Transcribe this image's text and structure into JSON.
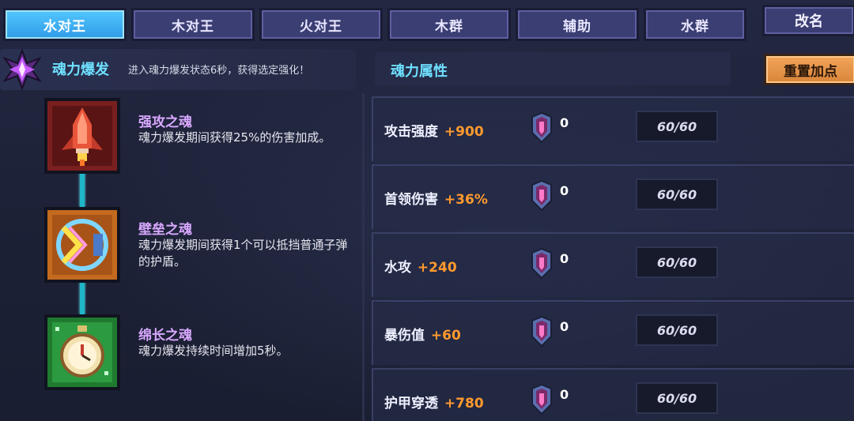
{
  "tabs": [
    {
      "label": "水对王",
      "active": true
    },
    {
      "label": "木对王",
      "active": false
    },
    {
      "label": "火对王",
      "active": false
    },
    {
      "label": "木群",
      "active": false
    },
    {
      "label": "辅助",
      "active": false
    },
    {
      "label": "水群",
      "active": false
    }
  ],
  "rename_label": "改名",
  "reset_label": "重置加点",
  "burst": {
    "title": "魂力爆发",
    "description": "进入魂力爆发状态6秒，获得选定强化！"
  },
  "souls": [
    {
      "name": "强攻之魂",
      "description": "魂力爆发期间获得25%的伤害加成。",
      "icon": "red-rocket-icon"
    },
    {
      "name": "壁垒之魂",
      "description": "魂力爆发期间获得1个可以抵挡普通子弹的护盾。",
      "icon": "orange-shield-icon"
    },
    {
      "name": "绵长之魂",
      "description": "魂力爆发持续时间增加5秒。",
      "icon": "green-clock-icon"
    }
  ],
  "attributes": {
    "title": "魂力属性",
    "rows": [
      {
        "label": "攻击强度",
        "bonus": "+900",
        "gems": "0",
        "level": "60/60"
      },
      {
        "label": "首领伤害",
        "bonus": "+36%",
        "gems": "0",
        "level": "60/60"
      },
      {
        "label": "水攻",
        "bonus": "+240",
        "gems": "0",
        "level": "60/60"
      },
      {
        "label": "暴伤值",
        "bonus": "+60",
        "gems": "0",
        "level": "60/60"
      },
      {
        "label": "护甲穿透",
        "bonus": "+780",
        "gems": "0",
        "level": "60/60"
      }
    ]
  },
  "colors": {
    "accent_cyan": "#6ee0ff",
    "bonus_orange": "#ff9a2e",
    "soul_name_purple": "#d8a8ff",
    "active_tab_blue": "#3aa9f0"
  }
}
